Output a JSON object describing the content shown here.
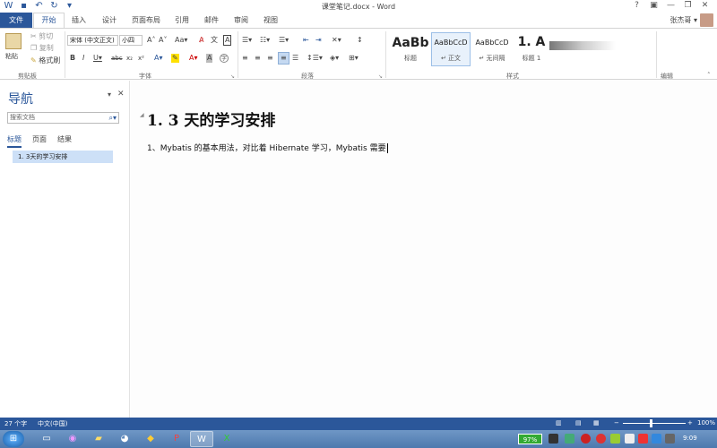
{
  "window": {
    "title": "课堂笔记.docx - Word"
  },
  "window_controls": {
    "help": "?",
    "restore_ribbon": "▣",
    "minimize": "—",
    "maximize": "❐",
    "close": "✕"
  },
  "tabs": {
    "file": "文件",
    "home": "开始",
    "insert": "插入",
    "design": "设计",
    "layout": "页面布局",
    "references": "引用",
    "mailings": "邮件",
    "review": "审阅",
    "view": "视图"
  },
  "user": {
    "name": "张杰哥 ▾"
  },
  "ribbon": {
    "clipboard": {
      "paste": "粘贴",
      "cut": "剪切",
      "copy": "复制",
      "format_painter": "格式刷",
      "label": "剪贴板"
    },
    "font": {
      "font_name": "宋体 (中文正文)",
      "font_size": "小四",
      "label": "字体"
    },
    "paragraph": {
      "label": "段落"
    },
    "styles": {
      "label": "样式",
      "items": [
        {
          "sample": "AaBb",
          "name": "标题"
        },
        {
          "sample": "AaBbCcD",
          "name": "↵ 正文"
        },
        {
          "sample": "AaBbCcD",
          "name": "↵ 无间隔"
        },
        {
          "sample": "1. A",
          "name": "标题 1"
        }
      ]
    },
    "editing": {
      "label": "编辑"
    }
  },
  "nav": {
    "title": "导航",
    "search_placeholder": "搜索文档",
    "tabs": [
      "标题",
      "页面",
      "结果"
    ],
    "items": [
      "1. 3天的学习安排"
    ]
  },
  "document": {
    "heading": "1. 3 天的学习安排",
    "paragraph": "1、Mybatis 的基本用法，对比着 Hibernate 学习，Mybatis 需要"
  },
  "status": {
    "word_count": "27 个字",
    "language": "中文(中国)",
    "zoom": "100%"
  },
  "taskbar": {
    "battery": "97%",
    "time": "9:09"
  }
}
